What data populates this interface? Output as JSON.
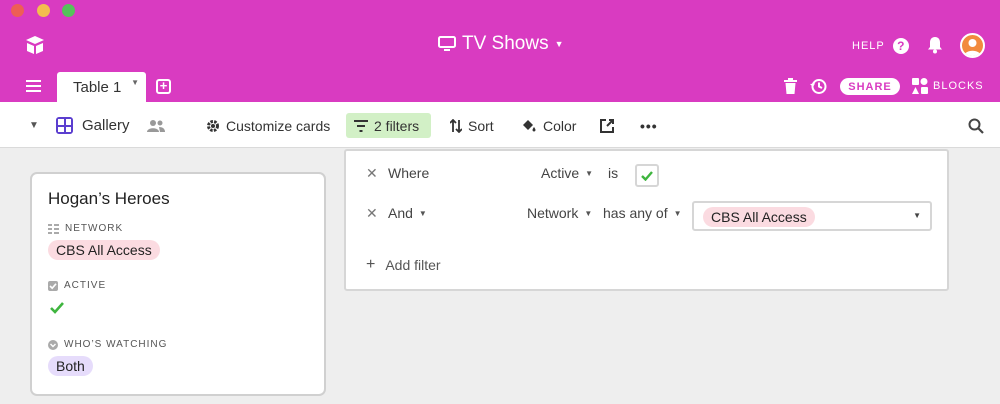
{
  "app": {
    "base_title": "TV Shows",
    "help_label": "HELP",
    "brand_color": "#d93bc1"
  },
  "tabs": {
    "active_table": "Table 1",
    "share_label": "SHARE",
    "blocks_label": "BLOCKS"
  },
  "toolbar": {
    "view_name": "Gallery",
    "customize_label": "Customize cards",
    "filters_label": "2 filters",
    "sort_label": "Sort",
    "color_label": "Color"
  },
  "card": {
    "title": "Hogan’s Heroes",
    "fields": [
      {
        "label": "NETWORK",
        "value": "CBS All Access"
      },
      {
        "label": "ACTIVE",
        "value": true
      },
      {
        "label": "WHO’S WATCHING",
        "value": "Both"
      }
    ]
  },
  "filter_panel": {
    "rows": [
      {
        "conjunction": "Where",
        "field": "Active",
        "operator": "is",
        "value_checked": true
      },
      {
        "conjunction": "And",
        "field": "Network",
        "operator": "has any of",
        "value": "CBS All Access"
      }
    ],
    "add_filter_label": "Add filter"
  },
  "icons": {
    "logo": "airtable-logo-icon",
    "monitor": "monitor-icon",
    "help": "help-circle-icon",
    "bell": "bell-icon",
    "trash": "trash-icon",
    "history": "history-icon",
    "blocks": "blocks-icon",
    "gallery": "gallery-icon",
    "people": "people-icon",
    "gear": "gear-icon",
    "filter": "filter-icon",
    "sort": "sort-icon",
    "color": "paint-bucket-icon",
    "share_view": "share-external-icon",
    "search": "search-icon"
  }
}
